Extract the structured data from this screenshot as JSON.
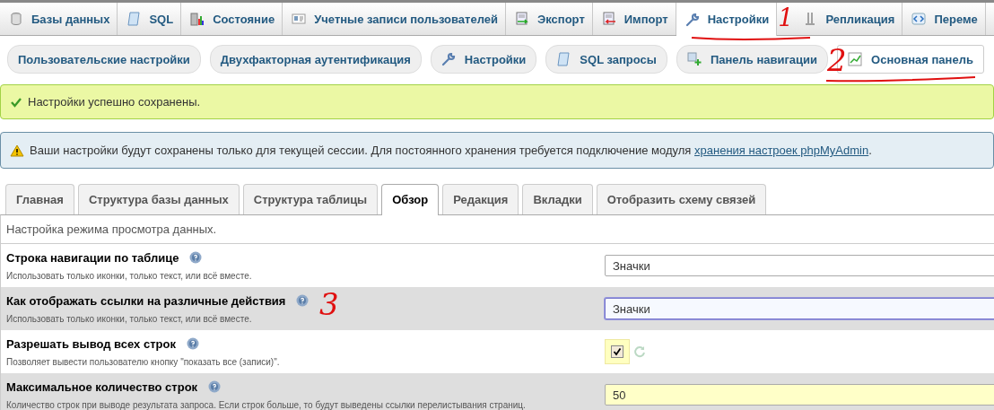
{
  "top_tabs": [
    {
      "label": "Базы данных",
      "selected": false
    },
    {
      "label": "SQL",
      "selected": false
    },
    {
      "label": "Состояние",
      "selected": false
    },
    {
      "label": "Учетные записи пользователей",
      "selected": false
    },
    {
      "label": "Экспорт",
      "selected": false
    },
    {
      "label": "Импорт",
      "selected": false
    },
    {
      "label": "Настройки",
      "selected": true
    },
    {
      "label": "Репликация",
      "selected": false
    },
    {
      "label": "Переме",
      "selected": false
    }
  ],
  "sub_buttons": [
    {
      "label": "Пользовательские настройки",
      "selected": false
    },
    {
      "label": "Двухфакторная аутентификация",
      "selected": false
    },
    {
      "label": "Настройки",
      "selected": false
    },
    {
      "label": "SQL запросы",
      "selected": false
    },
    {
      "label": "Панель навигации",
      "selected": false
    },
    {
      "label": "Основная панель",
      "selected": true
    }
  ],
  "success_message": "Настройки успешно сохранены.",
  "notice": {
    "text": "Ваши настройки будут сохранены только для текущей сессии. Для постоянного хранения требуется подключение модуля ",
    "link": "хранения настроек phpMyAdmin",
    "suffix": "."
  },
  "settings_tabs": [
    {
      "label": "Главная",
      "selected": false
    },
    {
      "label": "Структура базы данных",
      "selected": false
    },
    {
      "label": "Структура таблицы",
      "selected": false
    },
    {
      "label": "Обзор",
      "selected": true
    },
    {
      "label": "Редакция",
      "selected": false
    },
    {
      "label": "Вкладки",
      "selected": false
    },
    {
      "label": "Отобразить схему связей",
      "selected": false
    }
  ],
  "panel_description": "Настройка режима просмотра данных.",
  "settings": [
    {
      "kind": "select",
      "label": "Строка навигации по таблице",
      "description": "Использовать только иконки, только текст, или всё вместе.",
      "value": "Значки",
      "custom": false,
      "focused": false
    },
    {
      "kind": "select",
      "label": "Как отображать ссылки на различные действия",
      "description": "Использовать только иконки, только текст, или всё вместе.",
      "value": "Значки",
      "custom": false,
      "focused": true
    },
    {
      "kind": "checkbox",
      "label": "Разрешать вывод всех строк",
      "description": "Позволяет вывести пользователю кнопку \"показать все (записи)\".",
      "checked": true,
      "custom": true
    },
    {
      "kind": "number",
      "label": "Максимальное количество строк",
      "description": "Количество строк при выводе результата запроса. Если строк больше, то будут выведены ссылки перелистывания страниц.",
      "value": "50",
      "custom": true,
      "focused": false
    }
  ],
  "annotations": [
    {
      "text": "1"
    },
    {
      "text": "2"
    },
    {
      "text": "3"
    }
  ]
}
